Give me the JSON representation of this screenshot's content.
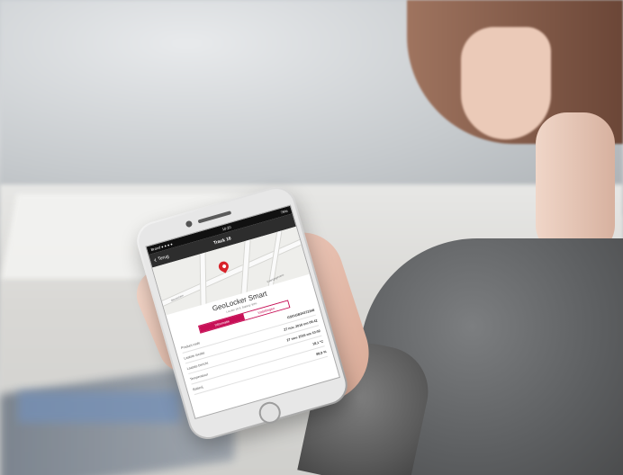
{
  "screen": {
    "status": {
      "left": "Brand ● ● ● ●",
      "time": "10:20",
      "right": "79%"
    },
    "navigation": {
      "back_label": "Terug",
      "title": "Track 16"
    },
    "map": {
      "label_left": "Beusichem",
      "label_right": "Kaartgegevens"
    },
    "device": {
      "title": "GeoLocker Smart",
      "subtitle": "Locatie 18-8, Batterij: 92%"
    },
    "tabs": {
      "active": "Informatie",
      "inactive": "Instellingen"
    },
    "details": [
      {
        "label": "Product code",
        "value": "GS01GB24372348"
      },
      {
        "label": "Laatste locatie",
        "value": "27 nov. 2016 om 09:42"
      },
      {
        "label": "Laatste bericht",
        "value": "27 nov. 2016 om 10:02"
      },
      {
        "label": "Temperatuur",
        "value": "18,1 °C"
      },
      {
        "label": "Batterij",
        "value": "88,9 %"
      }
    ]
  },
  "colors": {
    "accent": "#c70f56",
    "pin": "#d8232a"
  }
}
